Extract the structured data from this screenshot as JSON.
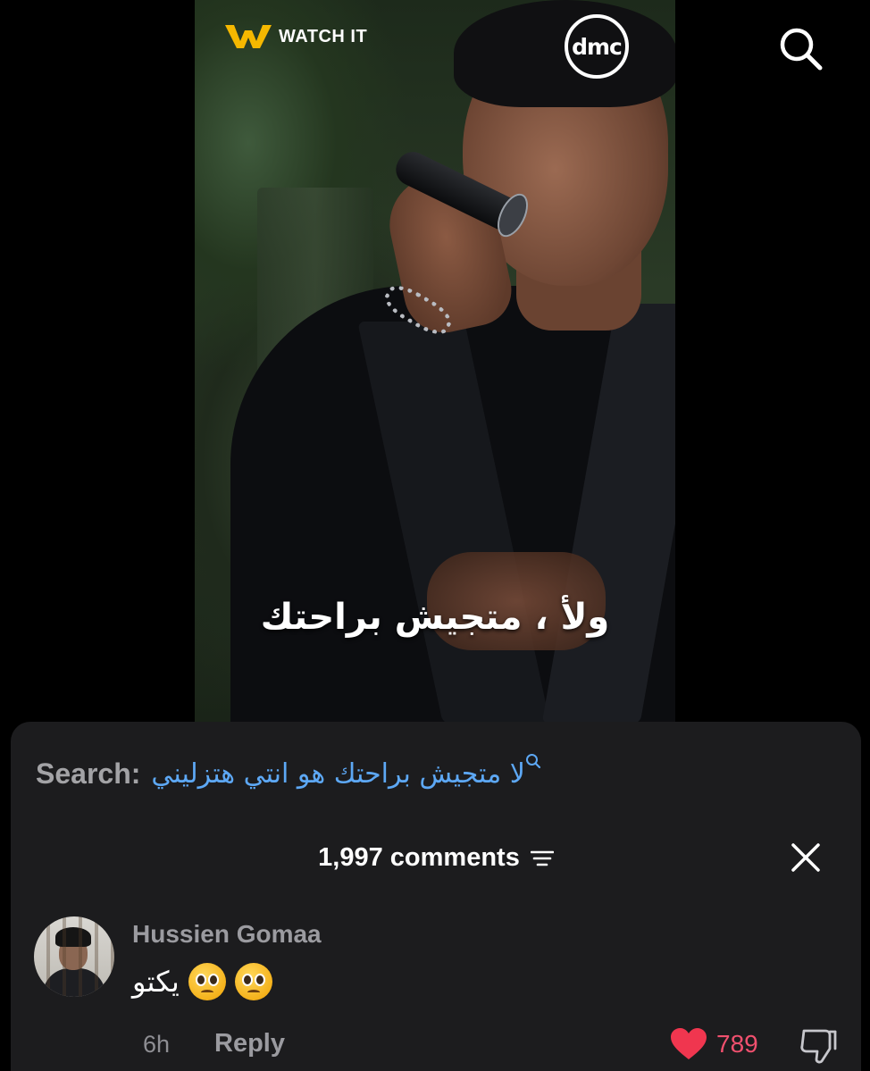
{
  "video": {
    "brand_left": "WATCH IT",
    "brand_right": "dmc",
    "subtitle": "ولأ ، متجيش براحتك",
    "icons": [
      "watch-it-logo",
      "dmc-logo",
      "search-icon"
    ]
  },
  "sheet": {
    "search_label": "Search:",
    "search_query": "لا متجيش براحتك هو انتي هتزليني",
    "comments_count": "1,997 comments",
    "icons": [
      "sort-icon",
      "close-icon"
    ]
  },
  "comment": {
    "username": "Hussien Gomaa",
    "text": "يكتو",
    "emojis": [
      "pleading-face",
      "pleading-face"
    ],
    "time": "6h",
    "reply_label": "Reply",
    "likes": "789",
    "icons": [
      "heart-icon",
      "dislike-icon"
    ]
  },
  "colors": {
    "background": "#000000",
    "sheet": "#1c1c1e",
    "search_query": "#5da8f5",
    "like": "#f0506e"
  }
}
